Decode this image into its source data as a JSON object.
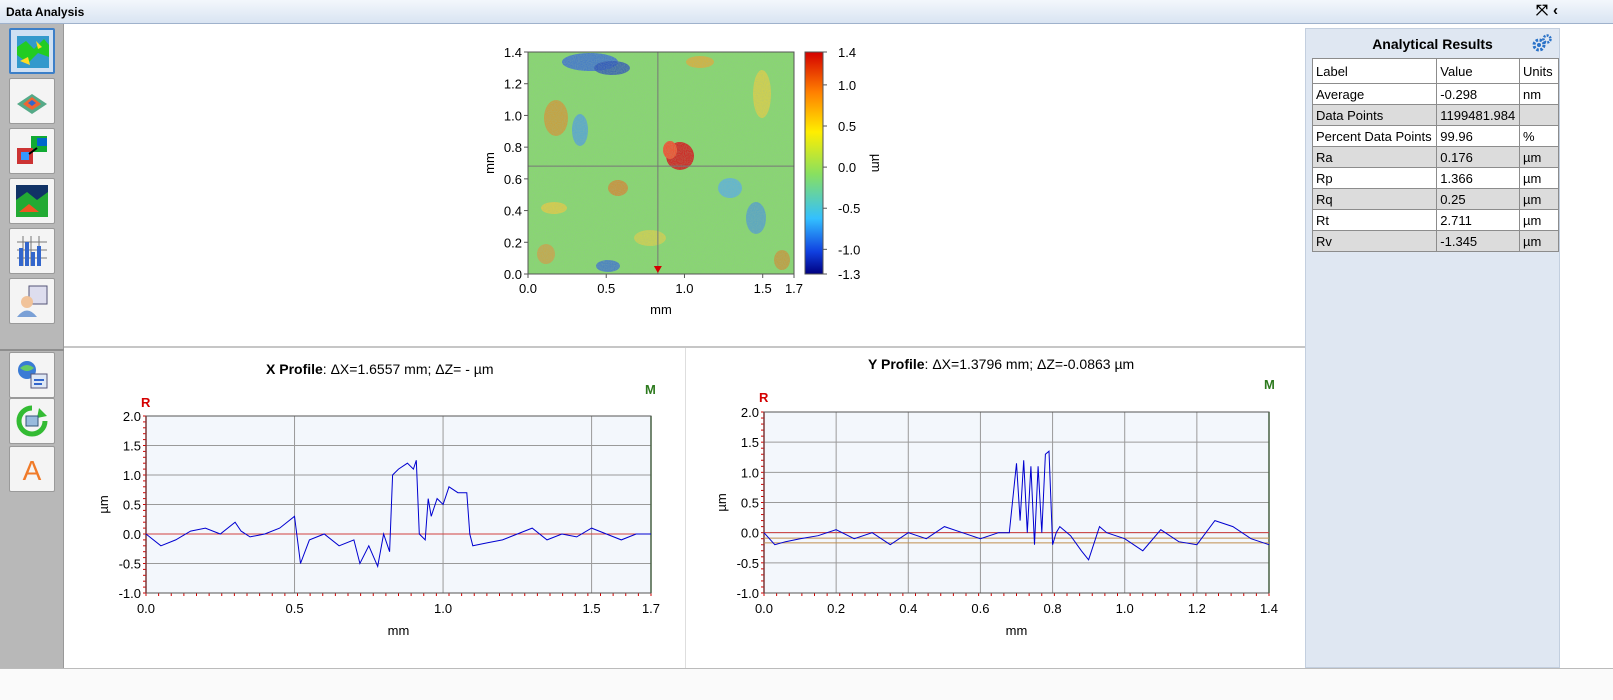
{
  "window": {
    "title": "Data Analysis",
    "expand_glyph": "⤧",
    "collapse_glyph": "‹"
  },
  "toolbar": {
    "items": [
      {
        "name": "surface-map-tool",
        "icon": "surface-map-icon"
      },
      {
        "name": "3d-view-tool",
        "icon": "3d-surface-icon"
      },
      {
        "name": "filter-tool",
        "icon": "filter-icon"
      },
      {
        "name": "height-map-tool",
        "icon": "height-map-icon"
      },
      {
        "name": "histogram-tool",
        "icon": "histogram-icon"
      },
      {
        "name": "user-view-tool",
        "icon": "user-view-icon"
      },
      {
        "name": "export-tool",
        "icon": "export-icon"
      },
      {
        "name": "refresh-tool",
        "icon": "refresh-icon"
      },
      {
        "name": "annotate-tool",
        "icon": "text-annotate-icon"
      }
    ]
  },
  "surface_map": {
    "x_ticks": [
      "0.0",
      "0.5",
      "1.0",
      "1.5",
      "1.7"
    ],
    "x_tick_values": [
      0,
      0.5,
      1.0,
      1.5,
      1.7
    ],
    "y_ticks": [
      "0.0",
      "0.2",
      "0.4",
      "0.6",
      "0.8",
      "1.0",
      "1.2",
      "1.4"
    ],
    "y_tick_values": [
      0,
      0.2,
      0.4,
      0.6,
      0.8,
      1.0,
      1.2,
      1.4
    ],
    "xlabel": "mm",
    "ylabel": "mm",
    "colorbar_ticks": [
      "1.4",
      "1.0",
      "0.5",
      "0.0",
      "-0.5",
      "-1.0",
      "-1.3"
    ],
    "colorbar_tick_values": [
      1.4,
      1.0,
      0.5,
      0.0,
      -0.5,
      -1.0,
      -1.3
    ],
    "colorbar_label": "µm",
    "crosshair": {
      "x": 0.83,
      "y": 0.68
    }
  },
  "x_profile": {
    "title_bold": "X Profile",
    "title_rest": ": ΔX=1.6557 mm; ΔZ= -  µm",
    "marker_r": "R",
    "marker_m": "M"
  },
  "y_profile": {
    "title_bold": "Y Profile",
    "title_rest": ": ΔX=1.3796 mm; ΔZ=-0.0863 µm",
    "marker_r": "R",
    "marker_m": "M"
  },
  "chart_data": [
    {
      "type": "line",
      "xlabel": "mm",
      "ylabel": "µm",
      "xlim": [
        0,
        1.7
      ],
      "ylim": [
        -1.0,
        2.0
      ],
      "x_ticks": [
        "0.0",
        "0.5",
        "1.0",
        "1.5",
        "1.7"
      ],
      "x_tick_values": [
        0,
        0.5,
        1.0,
        1.5,
        1.7
      ],
      "y_ticks": [
        "2.0",
        "1.5",
        "1.0",
        "0.5",
        "0.0",
        "-0.5",
        "-1.0"
      ],
      "y_tick_values": [
        2.0,
        1.5,
        1.0,
        0.5,
        0.0,
        -0.5,
        -1.0
      ],
      "reference_lines": [
        0.0
      ],
      "series": [
        {
          "x": [
            0.0,
            0.05,
            0.1,
            0.15,
            0.2,
            0.25,
            0.3,
            0.32,
            0.35,
            0.4,
            0.45,
            0.5,
            0.52,
            0.55,
            0.6,
            0.65,
            0.7,
            0.72,
            0.75,
            0.78,
            0.8,
            0.82,
            0.83,
            0.85,
            0.88,
            0.9,
            0.91,
            0.92,
            0.94,
            0.95,
            0.96,
            0.98,
            1.0,
            1.02,
            1.05,
            1.08,
            1.09,
            1.1,
            1.15,
            1.2,
            1.25,
            1.3,
            1.35,
            1.4,
            1.45,
            1.5,
            1.55,
            1.6,
            1.65,
            1.7
          ],
          "y": [
            0.0,
            -0.2,
            -0.1,
            0.05,
            0.1,
            0.0,
            0.2,
            0.05,
            -0.05,
            0.0,
            0.1,
            0.3,
            -0.5,
            -0.1,
            0.0,
            -0.2,
            -0.1,
            -0.5,
            -0.2,
            -0.55,
            0.0,
            -0.3,
            1.0,
            1.1,
            1.2,
            1.1,
            1.25,
            0.0,
            -0.1,
            0.6,
            0.3,
            0.6,
            0.5,
            0.8,
            0.7,
            0.7,
            0.0,
            -0.2,
            -0.15,
            -0.1,
            0.0,
            0.1,
            -0.1,
            0.0,
            -0.05,
            0.1,
            0.0,
            -0.1,
            0.0,
            0.0
          ]
        }
      ]
    },
    {
      "type": "line",
      "xlabel": "mm",
      "ylabel": "µm",
      "xlim": [
        0,
        1.4
      ],
      "ylim": [
        -1.0,
        2.0
      ],
      "x_ticks": [
        "0.0",
        "0.2",
        "0.4",
        "0.6",
        "0.8",
        "1.0",
        "1.2",
        "1.4"
      ],
      "x_tick_values": [
        0,
        0.2,
        0.4,
        0.6,
        0.8,
        1.0,
        1.2,
        1.4
      ],
      "y_ticks": [
        "2.0",
        "1.5",
        "1.0",
        "0.5",
        "0.0",
        "-0.5",
        "-1.0"
      ],
      "y_tick_values": [
        2.0,
        1.5,
        1.0,
        0.5,
        0.0,
        -0.5,
        -1.0
      ],
      "reference_lines": [
        0.0,
        -0.09,
        -0.17
      ],
      "series": [
        {
          "x": [
            0.0,
            0.03,
            0.06,
            0.1,
            0.15,
            0.2,
            0.25,
            0.3,
            0.35,
            0.4,
            0.45,
            0.5,
            0.55,
            0.6,
            0.65,
            0.68,
            0.7,
            0.71,
            0.72,
            0.73,
            0.74,
            0.75,
            0.76,
            0.77,
            0.78,
            0.79,
            0.8,
            0.81,
            0.82,
            0.85,
            0.88,
            0.9,
            0.93,
            0.95,
            1.0,
            1.05,
            1.1,
            1.15,
            1.2,
            1.25,
            1.3,
            1.35,
            1.4
          ],
          "y": [
            0.0,
            -0.2,
            -0.15,
            -0.1,
            -0.05,
            0.05,
            -0.1,
            0.0,
            -0.2,
            0.0,
            -0.1,
            0.1,
            0.0,
            -0.1,
            0.0,
            0.0,
            1.15,
            0.2,
            1.2,
            0.0,
            1.1,
            -0.2,
            1.1,
            0.0,
            1.3,
            1.35,
            -0.2,
            0.0,
            0.1,
            -0.05,
            -0.3,
            -0.45,
            0.1,
            0.0,
            -0.1,
            -0.3,
            0.05,
            -0.15,
            -0.2,
            0.2,
            0.1,
            -0.1,
            -0.2
          ]
        }
      ]
    }
  ],
  "results": {
    "title": "Analytical Results",
    "columns": [
      "Label",
      "Value",
      "Units"
    ],
    "rows": [
      [
        "Average",
        "-0.298",
        "nm"
      ],
      [
        "Data Points",
        "1199481.984",
        ""
      ],
      [
        "Percent Data Points",
        "99.96",
        "%"
      ],
      [
        "Ra",
        "0.176",
        "µm"
      ],
      [
        "Rp",
        "1.366",
        "µm"
      ],
      [
        "Rq",
        "0.25",
        "µm"
      ],
      [
        "Rt",
        "2.711",
        "µm"
      ],
      [
        "Rv",
        "-1.345",
        "µm"
      ]
    ]
  }
}
